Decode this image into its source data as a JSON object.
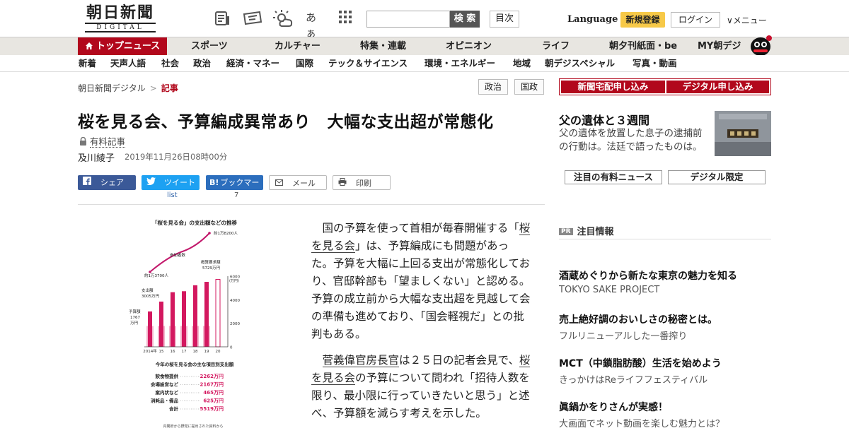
{
  "header": {
    "logo_main": "朝日新聞",
    "logo_sub": "DIGITAL",
    "kana_icon": "あぁ",
    "search_button": "検 索",
    "index_button": "目次",
    "language": "Language",
    "signup": "新規登録",
    "login": "ログイン",
    "menu": "メニュー",
    "menu_arrow": "∨"
  },
  "nav_main": [
    "トップニュース",
    "スポーツ",
    "カルチャー",
    "特集・連載",
    "オピニオン",
    "ライフ",
    "朝夕刊紙面・be",
    "MY朝デジ"
  ],
  "nav_sub": [
    "新着",
    "天声人語",
    "社会",
    "政治",
    "経済・マネー",
    "国際",
    "テック＆サイエンス",
    "環境・エネルギー",
    "地域",
    "朝デジスペシャル",
    "写真・動画"
  ],
  "breadcrumb": {
    "home": "朝日新聞デジタル",
    "separator": ">",
    "current": "記事"
  },
  "tags": [
    "政治",
    "国政"
  ],
  "article": {
    "title": "桜を見る会、予算編成異常あり　大幅な支出超が常態化",
    "paid_label": "有料記事",
    "author": "及川綾子",
    "date": "2019年11月26日08時00分",
    "paragraphs": [
      {
        "before": "国の予算を使って首相が毎春開催する「",
        "link": "桜を見る会",
        "after": "」は、予算編成にも問題があった。予算を大幅に上回る支出が常態化しており、官邸幹部も「望ましくない」と認める。予算の成立前から大幅な支出超を見越して会の準備も進めており、「国会軽視だ」との批判もある。"
      },
      {
        "before": "",
        "link": "菅義偉官房長官",
        "after": "は２５日の記者会見で、",
        "link2": "桜を見る会",
        "after2": "の予算について問われ「招待人数を限り、最小限に行っていきたいと思う」と述べ、予算額を減らす考えを示した。"
      }
    ]
  },
  "share": {
    "facebook": "シェア",
    "twitter": "ツイート",
    "twitter_count": "list",
    "hatena": "ブックマーク",
    "hatena_icon": "B!",
    "hatena_count": "7",
    "mail": "メール",
    "print": "印刷"
  },
  "chart_data": {
    "type": "bar",
    "title": "「桜を見る会」の支出額などの推移",
    "categories": [
      "2014年",
      "15",
      "16",
      "17",
      "18",
      "19",
      "20"
    ],
    "series": [
      {
        "name": "予算額",
        "values": [
          1767,
          1767,
          1767,
          1767,
          1767,
          1767,
          null
        ]
      },
      {
        "name": "支出額",
        "values": [
          3005,
          3842,
          4639,
          4723,
          5229,
          5519,
          5729
        ]
      }
    ],
    "line_series": {
      "name": "参加者数",
      "start_label": "約1万3700人",
      "end_label": "約1万8200人"
    },
    "annotations": [
      "予算額 1767 万円",
      "支出額 3005万円",
      "参加者数",
      "概算要求額 5729万円",
      "約1万3700人",
      "約1万8200人"
    ],
    "ylabel": "(万円)",
    "yticks": [
      "6000",
      "4000",
      "2000",
      "0"
    ],
    "ylim": [
      0,
      6000
    ],
    "table_title": "今年の桜を見る会の主な項目別支出額",
    "table": [
      {
        "item": "飲食物提供",
        "value": "2262万円"
      },
      {
        "item": "会場設営など",
        "value": "2167万円"
      },
      {
        "item": "案内状など",
        "value": "465万円"
      },
      {
        "item": "消耗品・備品",
        "value": "625万円"
      },
      {
        "item": "合計",
        "value": "5519万円"
      }
    ],
    "source": "内閣府から野党に提出された資料から",
    "colors": {
      "budget": "#f3b7cd",
      "spend": "#d3185f",
      "line": "#c2186b"
    }
  },
  "sidebar": {
    "btn_delivery": "新聞宅配申し込み",
    "btn_digital": "デジタル申し込み",
    "feature_title": "父の遺体と３週間",
    "feature_desc": "父の遺体を放置した息子の逮捕前の行動は。法廷で語ったものは。",
    "btn_paid_news": "注目の有料ニュース",
    "btn_digital_only": "デジタル限定",
    "pr_badge": "PR",
    "pr_heading": "注目情報",
    "pr_items": [
      {
        "title": "酒蔵めぐりから新たな東京の魅力を知る",
        "sub": "TOKYO SAKE PROJECT"
      },
      {
        "title": "売上絶好調のおいしさの秘密とは。",
        "sub": "フルリニューアルした一番搾り"
      },
      {
        "title": "MCT（中鎖脂肪酸）生活を始めよう",
        "sub": "きっかけはReライフフェスティバル"
      },
      {
        "title": "眞鍋かをりさんが実感！",
        "sub": "大画面でネット動画を楽しむ魅力とは？"
      }
    ]
  },
  "colors": {
    "brand_red": "#b2081c",
    "nav_bg": "#e8e6e1",
    "signup_yellow": "#f7c948"
  }
}
